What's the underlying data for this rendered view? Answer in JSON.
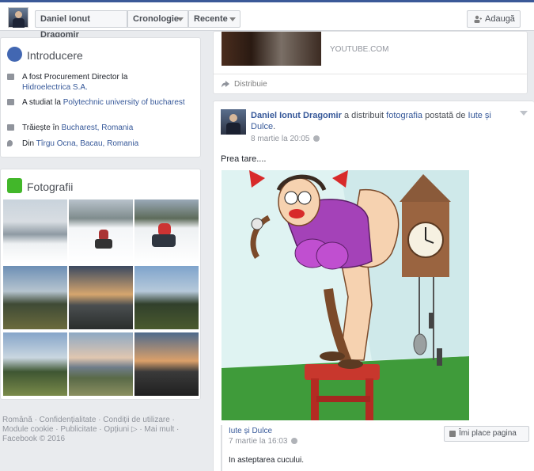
{
  "topbar": {
    "profile_name": "Daniel Ionut Dragomir",
    "timeline_label": "Cronologie",
    "recent_label": "Recente",
    "add_label": "Adaugă"
  },
  "intro": {
    "title": "Introducere",
    "rows": [
      {
        "prefix": "A fost Procurement Director la",
        "link": "Hidroelectrica S.A."
      },
      {
        "prefix": "A studiat la",
        "link": "Polytechnic university of bucharest"
      },
      {
        "prefix": "Trăiește în",
        "link": "Bucharest, Romania"
      },
      {
        "prefix": "Din",
        "link": "Tîrgu Ocna, Bacau, Romania"
      }
    ]
  },
  "photos": {
    "title": "Fotografii"
  },
  "footer": {
    "line1": "Română · Confidențialitate · Condiții de utilizare ·",
    "line2": "Module cookie · Publicitate · Opțiuni ▷ · Mai mult ·",
    "line3": "Facebook © 2016"
  },
  "feed_top": {
    "source": "YOUTUBE.COM",
    "share_label": "Distribuie"
  },
  "post": {
    "author": "Daniel Ionut Dragomir",
    "action": " a distribuit ",
    "object": "fotografia",
    "posted_by": " postată de ",
    "origin_page_1": "Iute și",
    "origin_page_2": "Dulce",
    "date": "8 martie la 20:05",
    "text": "Prea tare....",
    "shared": {
      "page_name": "Iute și Dulce",
      "date": "7 martie la 16:03",
      "like_page_label": "Îmi place pagina",
      "text": "In asteptarea cucului."
    }
  },
  "colors": {
    "brand_blue": "#3b5998",
    "link": "#365899",
    "page_bg": "#e9ebee"
  }
}
